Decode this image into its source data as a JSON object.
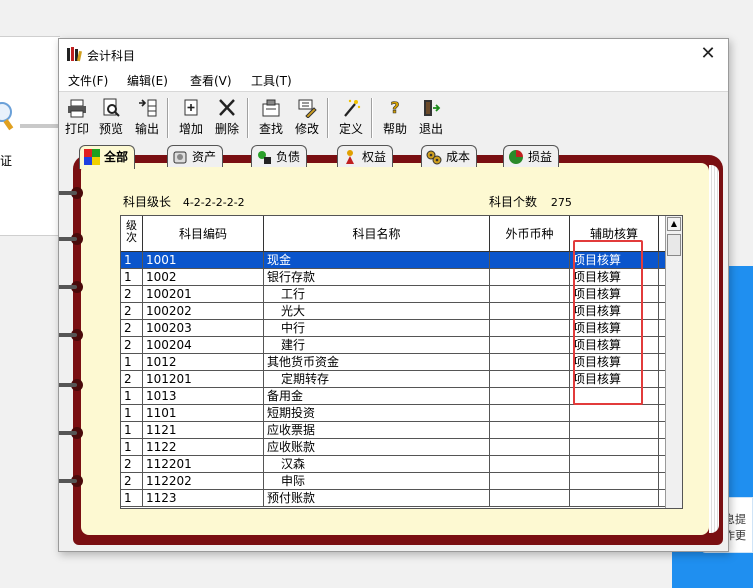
{
  "background": {
    "left_text": "证",
    "right_card_text_1": "信息提",
    "right_card_text_2": "工作更"
  },
  "window": {
    "title": "会计科目",
    "close": "✕"
  },
  "menu": [
    "文件(F)",
    "编辑(E)",
    "查看(V)",
    "工具(T)"
  ],
  "toolbar": [
    {
      "label": "打印",
      "icon": "printer-icon"
    },
    {
      "label": "预览",
      "icon": "preview-icon"
    },
    {
      "label": "输出",
      "icon": "export-icon"
    },
    {
      "label": "增加",
      "icon": "add-icon"
    },
    {
      "label": "删除",
      "icon": "delete-icon"
    },
    {
      "label": "查找",
      "icon": "find-icon"
    },
    {
      "label": "修改",
      "icon": "edit-icon"
    },
    {
      "label": "定义",
      "icon": "magic-wand-icon"
    },
    {
      "label": "帮助",
      "icon": "help-icon"
    },
    {
      "label": "退出",
      "icon": "exit-icon"
    }
  ],
  "tabs": [
    "全部",
    "资产",
    "负债",
    "权益",
    "成本",
    "损益"
  ],
  "summary": {
    "level_label": "科目级长",
    "level_value": "4-2-2-2-2-2",
    "count_label": "科目个数",
    "count_value": "275"
  },
  "grid": {
    "headers": [
      "级次",
      "科目编码",
      "科目名称",
      "外币币种",
      "辅助核算"
    ],
    "rows": [
      {
        "level": "1",
        "code": "1001",
        "name": "现金",
        "currency": "",
        "aux": "项目核算",
        "selected": true
      },
      {
        "level": "1",
        "code": "1002",
        "name": "银行存款",
        "currency": "",
        "aux": "项目核算"
      },
      {
        "level": "2",
        "code": "100201",
        "name": "工行",
        "currency": "",
        "aux": "项目核算"
      },
      {
        "level": "2",
        "code": "100202",
        "name": "光大",
        "currency": "",
        "aux": "项目核算"
      },
      {
        "level": "2",
        "code": "100203",
        "name": "中行",
        "currency": "",
        "aux": "项目核算"
      },
      {
        "level": "2",
        "code": "100204",
        "name": "建行",
        "currency": "",
        "aux": "项目核算"
      },
      {
        "level": "1",
        "code": "1012",
        "name": "其他货币资金",
        "currency": "",
        "aux": "项目核算"
      },
      {
        "level": "2",
        "code": "101201",
        "name": "定期转存",
        "currency": "",
        "aux": "项目核算"
      },
      {
        "level": "1",
        "code": "1013",
        "name": "备用金",
        "currency": "",
        "aux": ""
      },
      {
        "level": "1",
        "code": "1101",
        "name": "短期投资",
        "currency": "",
        "aux": ""
      },
      {
        "level": "1",
        "code": "1121",
        "name": "应收票据",
        "currency": "",
        "aux": ""
      },
      {
        "level": "1",
        "code": "1122",
        "name": "应收账款",
        "currency": "",
        "aux": ""
      },
      {
        "level": "2",
        "code": "112201",
        "name": "汉森",
        "currency": "",
        "aux": ""
      },
      {
        "level": "2",
        "code": "112202",
        "name": "申际",
        "currency": "",
        "aux": ""
      },
      {
        "level": "1",
        "code": "1123",
        "name": "预付账款",
        "currency": "",
        "aux": ""
      }
    ]
  },
  "colors": {
    "selection": "#0a55cc",
    "book_cover": "#7a0f12",
    "page": "#fdf9d2",
    "highlight_box": "#e23b3b"
  }
}
